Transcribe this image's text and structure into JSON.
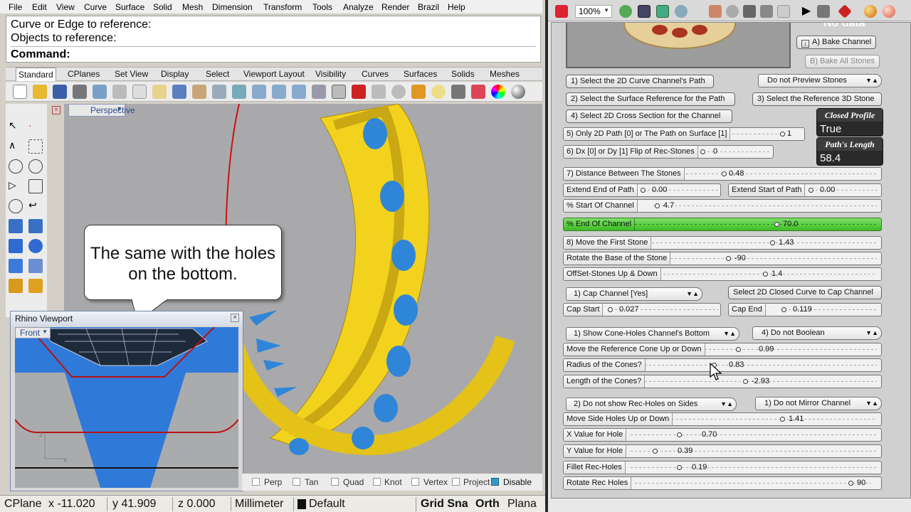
{
  "rhino": {
    "menu": [
      "File",
      "Edit",
      "View",
      "Curve",
      "Surface",
      "Solid",
      "Mesh",
      "Dimension",
      "Transform",
      "Tools",
      "Analyze",
      "Render",
      "Brazil",
      "Help"
    ],
    "command_history": [
      "Curve or Edge to reference:",
      "Objects to reference:"
    ],
    "command_prompt": "Command:",
    "toolbar_tabs": [
      "Standard",
      "CPlanes",
      "Set View",
      "Display",
      "Select",
      "Viewport Layout",
      "Visibility",
      "Curves",
      "Surfaces",
      "Solids",
      "Meshes"
    ],
    "viewport_name": "Perspective",
    "callout_text": "The same with the holes on the bottom.",
    "mini_viewport": {
      "title": "Rhino Viewport",
      "view": "Front",
      "axis_x": "x",
      "axis_z": "z"
    },
    "osnap": [
      "Perp",
      "Tan",
      "Quad",
      "Knot",
      "Vertex",
      "Project",
      "Disable"
    ],
    "status": {
      "cplane": "CPlane",
      "x": "x -11.020",
      "y": "y 41.909",
      "z": "z 0.000",
      "units": "Millimeter",
      "layer": "Default",
      "grid_snap": "Grid Sna",
      "ortho": "Orth",
      "planar": "Plana"
    },
    "colors": {
      "object_yellow": "#f2d21c",
      "stones_blue": "#2f86d8",
      "curve_red": "#cc1111"
    }
  },
  "gh": {
    "zoom": "100%",
    "no_data": "No data",
    "buttons": {
      "bake_channel": "A) Bake Channel",
      "bake_all_stones": "B) Bake All Stones",
      "select_curve": "1) Select the 2D Curve Channel's Path",
      "do_not_preview": "Do not Preview Stones",
      "select_surface": "2) Select the Surface Reference for the Path",
      "select_stone": "3) Select the Reference 3D Stone",
      "select_cross": "4) Select 2D Cross Section for the Channel",
      "cap_channel": "1) Cap Channel [Yes]",
      "select_closed_curve": "Select 2D Closed Curve to Cap Channel",
      "show_cone_holes": "1) Show Cone-Holes Channel's Bottom",
      "do_not_boolean": "4) Do not Boolean",
      "do_not_show_rec": "2) Do not show Rec-Holes on Sides",
      "do_not_mirror": "1) Do not Mirror Channel"
    },
    "panels": {
      "closed_profile": {
        "title": "Closed Profile",
        "value": "True"
      },
      "path_length": {
        "title": "Path's Length",
        "value": "58.4"
      }
    },
    "sliders": [
      {
        "label": "5) Only 2D Path [0] or The Path on Surface [1]",
        "value": "1",
        "fraction": 0.85
      },
      {
        "label": "6) Dx [0] or Dy [1] Flip of Rec-Stones",
        "value": "0",
        "fraction": 0.0
      },
      {
        "label": "7) Distance Between The Stones",
        "value": "0.48",
        "fraction": 0.2
      },
      {
        "label": "Extend End of Path",
        "value": "0.00",
        "fraction": 0.0
      },
      {
        "label": "Extend Start of Path",
        "value": "0.00",
        "fraction": 0.0
      },
      {
        "label": "% Start Of Channel",
        "value": "4.7",
        "fraction": 0.03
      },
      {
        "label": "% End Of Channel",
        "value": "70.0",
        "fraction": 0.68
      },
      {
        "label": "8) Move the First Stone",
        "value": "1.43",
        "fraction": 0.6
      },
      {
        "label": "Rotate the Base of the Stone",
        "value": "-90",
        "fraction": 0.3
      },
      {
        "label": "OffSet-Stones Up & Down",
        "value": "1.4",
        "fraction": 0.55
      },
      {
        "label": "Cap Start",
        "value": "0.027",
        "fraction": 0.0
      },
      {
        "label": "Cap End",
        "value": "0.119",
        "fraction": 0.0
      },
      {
        "label": "Move the Reference Cone Up or Down",
        "value": "0.99",
        "fraction": 0.2
      },
      {
        "label": "Radius of the Cones?",
        "value": "0.83",
        "fraction": 0.3
      },
      {
        "label": "Length of the Cones?",
        "value": "-2.93",
        "fraction": 0.55
      },
      {
        "label": "Move Side Holes Up or Down",
        "value": "1.41",
        "fraction": 0.6
      },
      {
        "label": "X Value for Hole",
        "value": "0.70",
        "fraction": 0.2
      },
      {
        "label": "Y Value for Hole",
        "value": "0.39",
        "fraction": 0.1
      },
      {
        "label": "Fillet Rec-Holes",
        "value": "0.19",
        "fraction": 0.2
      },
      {
        "label": "Rotate Rec Holes",
        "value": "90",
        "fraction": 1.0
      }
    ]
  }
}
